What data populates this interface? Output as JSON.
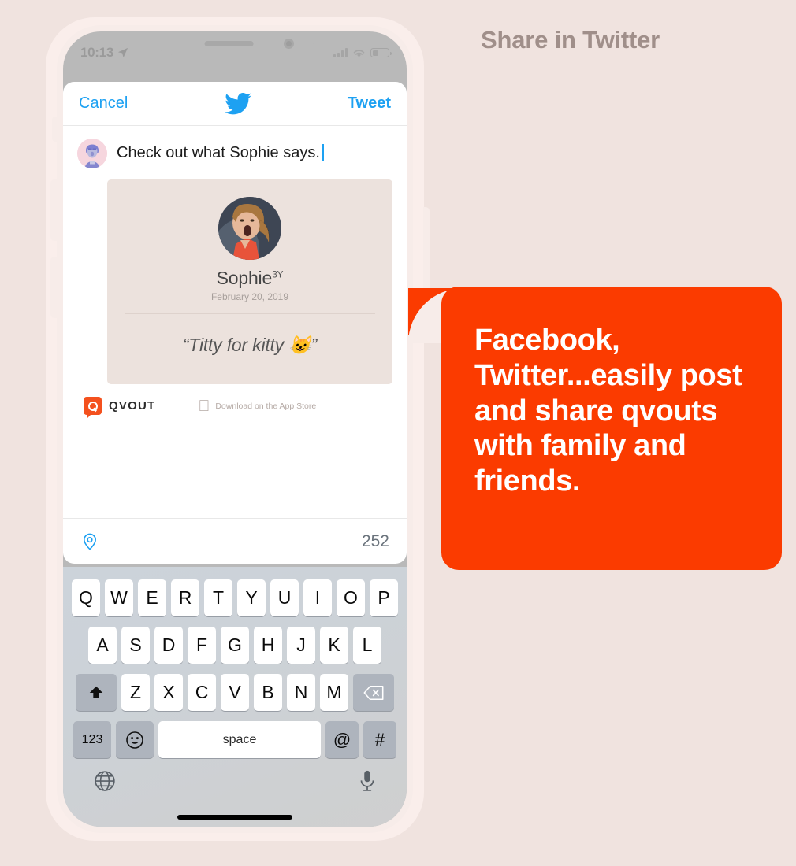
{
  "theme": {
    "page_bg": "#f0e3df",
    "accent_orange": "#fb3b00",
    "twitter_blue": "#1da1f2",
    "qvout_orange": "#f4511e",
    "headline_color": "#a08f8a"
  },
  "headline": "Share in Twitter",
  "callout": {
    "text": "Facebook, Twitter...easily post and share qvouts with family and friends."
  },
  "phone": {
    "status_bar": {
      "time": "10:13",
      "location_icon": "location-arrow-icon",
      "signal_icon": "cellular-bars-icon",
      "wifi_icon": "wifi-icon",
      "battery_icon": "battery-icon",
      "battery_level": "42%"
    },
    "sheet": {
      "cancel_label": "Cancel",
      "tweet_label": "Tweet",
      "logo_icon": "twitter-bird-icon",
      "avatar_icon": "user-avatar",
      "compose_text": "Check out what Sophie says.",
      "quote_card": {
        "photo_icon": "child-photo",
        "name": "Sophie",
        "age_badge": "3Y",
        "date": "February 20, 2019",
        "quote": "“Titty for kitty 😺”"
      },
      "brand": {
        "logo_icon": "qvout-logo-icon",
        "wordmark": "QVOUT",
        "apple_icon": "apple-icon",
        "appstore_label": "Download on the App Store"
      },
      "footer": {
        "location_icon": "location-pin-icon",
        "char_count": "252"
      }
    },
    "keyboard": {
      "row1": [
        "Q",
        "W",
        "E",
        "R",
        "T",
        "Y",
        "U",
        "I",
        "O",
        "P"
      ],
      "row2": [
        "A",
        "S",
        "D",
        "F",
        "G",
        "H",
        "J",
        "K",
        "L"
      ],
      "row3": [
        "Z",
        "X",
        "C",
        "V",
        "B",
        "N",
        "M"
      ],
      "shift_icon": "shift-up-icon",
      "backspace_icon": "backspace-icon",
      "numbers_label": "123",
      "emoji_icon": "emoji-smiley-icon",
      "space_label": "space",
      "at_label": "@",
      "hash_label": "#",
      "globe_icon": "globe-icon",
      "mic_icon": "microphone-icon"
    }
  }
}
